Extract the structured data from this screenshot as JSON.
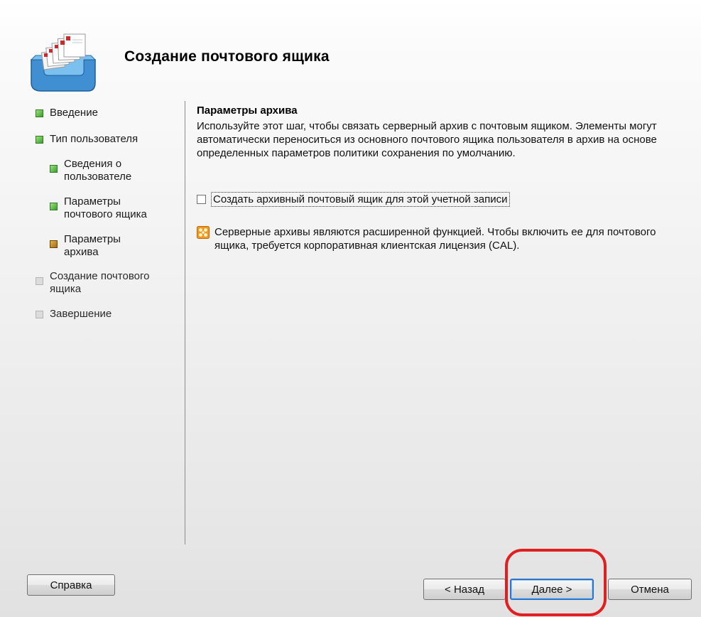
{
  "header": {
    "title": "Создание почтового ящика",
    "icon": "mailbox-tray-icon"
  },
  "steps": [
    {
      "label": "Введение",
      "state": "done"
    },
    {
      "label": "Тип пользователя",
      "state": "done"
    },
    {
      "label": "Сведения о пользователе",
      "state": "done"
    },
    {
      "label": "Параметры почтового ящика",
      "state": "done"
    },
    {
      "label": "Параметры архива",
      "state": "current"
    },
    {
      "label": "Создание почтового ящика",
      "state": "pending"
    },
    {
      "label": "Завершение",
      "state": "pending"
    }
  ],
  "content": {
    "section_title": "Параметры архива",
    "description": "Используйте этот шаг, чтобы связать серверный архив с почтовым ящиком. Элементы могут автоматически переноситься из основного почтового ящика пользователя в архив на основе определенных параметров политики сохранения по умолчанию.",
    "checkbox_label": "Создать архивный почтовый ящик для этой учетной записи",
    "checkbox_checked": false,
    "info_text": "Серверные архивы являются расширенной функцией. Чтобы включить ее для почтового ящика, требуется корпоративная клиентская лицензия (CAL)."
  },
  "buttons": {
    "help": "Справка",
    "back": "< Назад",
    "next": "Далее >",
    "cancel": "Отмена"
  },
  "colors": {
    "highlight": "#e02020",
    "step_done": "#3aa02e",
    "step_current": "#c88a20",
    "step_pending": "#dcdcdc"
  }
}
